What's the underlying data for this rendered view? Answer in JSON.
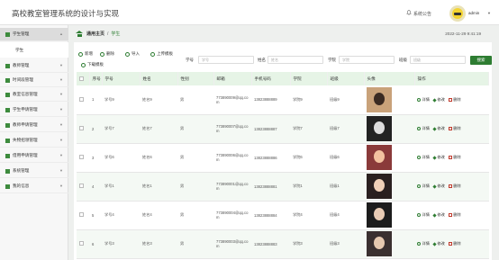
{
  "app": {
    "title": "高校教室管理系统的设计与实现"
  },
  "header": {
    "notice_label": "系统公告",
    "username": "admin",
    "caret": "▼"
  },
  "sidebar": {
    "items": [
      {
        "label": "学生管理",
        "chevron": "▲",
        "active": true
      },
      {
        "label": "教师管理",
        "chevron": "▼"
      },
      {
        "label": "时间段管理",
        "chevron": "▼"
      },
      {
        "label": "教室信息管理",
        "chevron": "▼"
      },
      {
        "label": "学生申请管理",
        "chevron": "▼"
      },
      {
        "label": "教师申请管理",
        "chevron": "▼"
      },
      {
        "label": "失物招领管理",
        "chevron": "▼"
      },
      {
        "label": "借用申请管理",
        "chevron": "▼"
      },
      {
        "label": "系统管理",
        "chevron": "▼"
      },
      {
        "label": "我的信息",
        "chevron": "▼"
      }
    ],
    "submenu_label": "学生"
  },
  "breadcrumb": {
    "home": "通用主页",
    "separator": "/",
    "current": "学生",
    "datetime": "2022-11-29 9:41:19"
  },
  "toolbar": {
    "add": "新增",
    "delete": "删除",
    "import": "导入",
    "upload": "上传模板",
    "download": "下载模板"
  },
  "search": {
    "fields": [
      {
        "label": "学号",
        "placeholder": "学号"
      },
      {
        "label": "姓名",
        "placeholder": "姓名"
      },
      {
        "label": "学院",
        "placeholder": "学院"
      },
      {
        "label": "班级",
        "placeholder": "班级"
      }
    ],
    "button": "搜索"
  },
  "table": {
    "headers": [
      "",
      "序号",
      "学号",
      "姓名",
      "性别",
      "邮箱",
      "手机号码",
      "学院",
      "班级",
      "头像",
      "操作"
    ],
    "rows": [
      {
        "idx": "1",
        "sid": "学号9",
        "name": "姓名9",
        "sex": "男",
        "email": "773890009@qq.com",
        "phone": "13823888889",
        "college": "学院9",
        "cls": "班级9"
      },
      {
        "idx": "2",
        "sid": "学号7",
        "name": "姓名7",
        "sex": "男",
        "email": "773890007@qq.com",
        "phone": "13823888887",
        "college": "学院7",
        "cls": "班级7"
      },
      {
        "idx": "3",
        "sid": "学号6",
        "name": "姓名6",
        "sex": "男",
        "email": "773890006@qq.com",
        "phone": "13823888886",
        "college": "学院6",
        "cls": "班级6"
      },
      {
        "idx": "4",
        "sid": "学号1",
        "name": "姓名1",
        "sex": "男",
        "email": "773890001@qq.com",
        "phone": "13823888881",
        "college": "学院1",
        "cls": "班级1"
      },
      {
        "idx": "5",
        "sid": "学号4",
        "name": "姓名4",
        "sex": "男",
        "email": "773890004@qq.com",
        "phone": "13823888884",
        "college": "学院4",
        "cls": "班级4"
      },
      {
        "idx": "6",
        "sid": "学号3",
        "name": "姓名3",
        "sex": "男",
        "email": "773890003@qq.com",
        "phone": "13823888883",
        "college": "学院3",
        "cls": "班级3"
      }
    ],
    "actions": {
      "view": "详情",
      "edit": "修改",
      "del": "删除"
    }
  },
  "colors": {
    "accent": "#2e7d32",
    "header_bg": "#e6f4e6",
    "row_alt": "#f4f9f4"
  }
}
